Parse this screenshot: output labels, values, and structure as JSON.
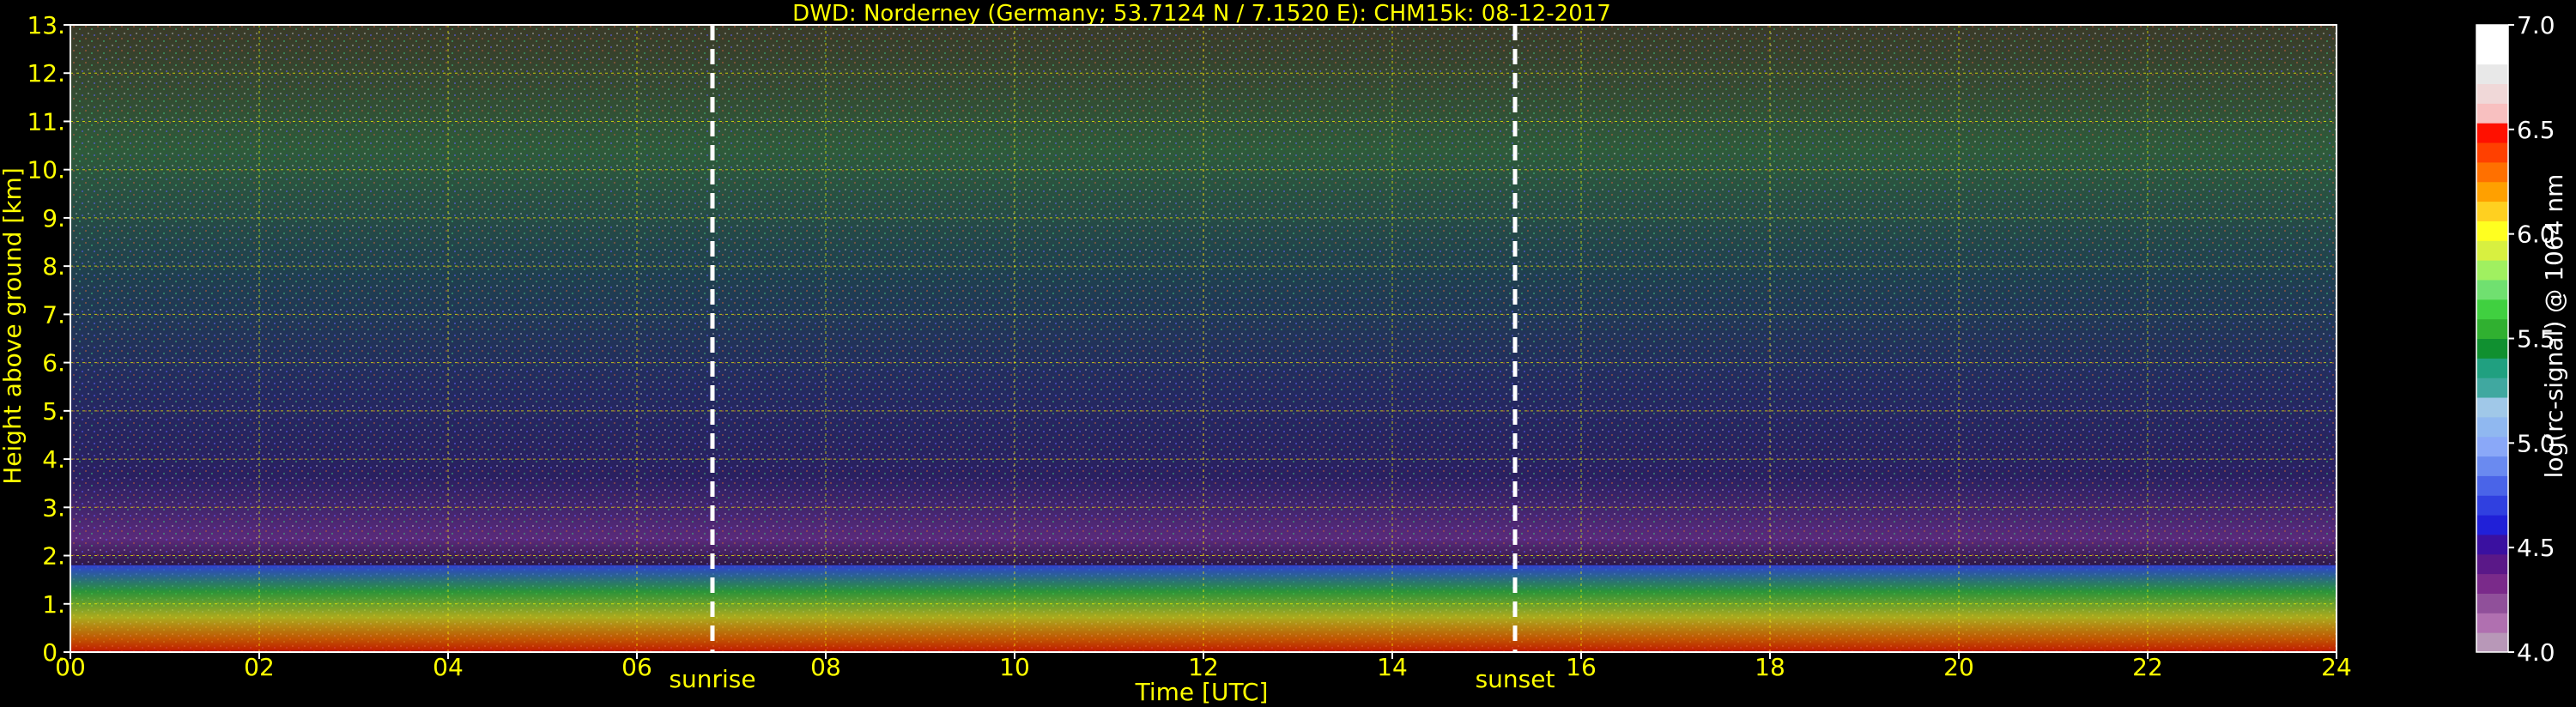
{
  "chart_data": {
    "type": "heatmap",
    "title": "DWD: Norderney (Germany; 53.7124 N / 7.1520 E):    CHM15k: 08-12-2017",
    "xlabel": "Time [UTC]",
    "ylabel": "Height above ground [km]",
    "xlim": [
      0,
      24
    ],
    "ylim": [
      0,
      13
    ],
    "x_ticks": [
      "00",
      "02",
      "04",
      "06",
      "08",
      "10",
      "12",
      "14",
      "16",
      "18",
      "20",
      "22",
      "24"
    ],
    "y_ticks": [
      "0.",
      "1.",
      "2.",
      "3.",
      "4.",
      "5.",
      "6.",
      "7.",
      "8.",
      "9.",
      "10.",
      "11.",
      "12.",
      "13."
    ],
    "grid": true,
    "markers": [
      {
        "label": "sunrise",
        "time": 6.8
      },
      {
        "label": "sunset",
        "time": 15.3
      }
    ],
    "colorbar": {
      "label": "log(rc-signal) @ 1064 nm",
      "range": [
        4.0,
        7.0
      ],
      "ticks": [
        "4.0",
        "4.5",
        "5.0",
        "5.5",
        "6.0",
        "6.5",
        "7.0"
      ]
    },
    "colors": {
      "text": "#ffff00",
      "grid": "#ffff00",
      "background": "#000000",
      "marker": "#ffffff"
    }
  }
}
